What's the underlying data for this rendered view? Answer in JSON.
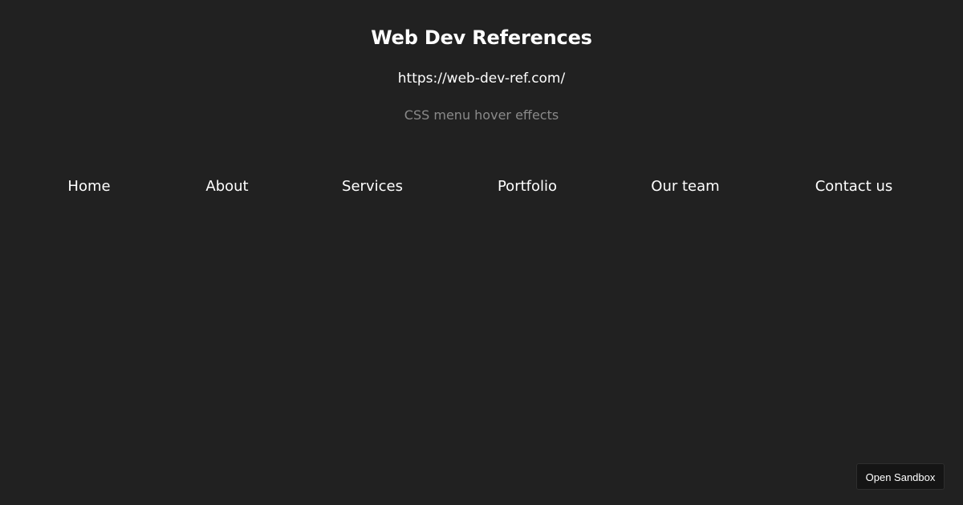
{
  "header": {
    "title": "Web Dev References",
    "url": "https://web-dev-ref.com/",
    "subtitle": "CSS menu hover effects"
  },
  "nav": {
    "items": [
      {
        "label": "Home"
      },
      {
        "label": "About"
      },
      {
        "label": "Services"
      },
      {
        "label": "Portfolio"
      },
      {
        "label": "Our team"
      },
      {
        "label": "Contact us"
      }
    ]
  },
  "sandbox": {
    "label": "Open Sandbox"
  },
  "colors": {
    "background": "#212121",
    "text": "#ffffff",
    "subtitle": "#8a8a8a",
    "button_background": "#151515"
  }
}
